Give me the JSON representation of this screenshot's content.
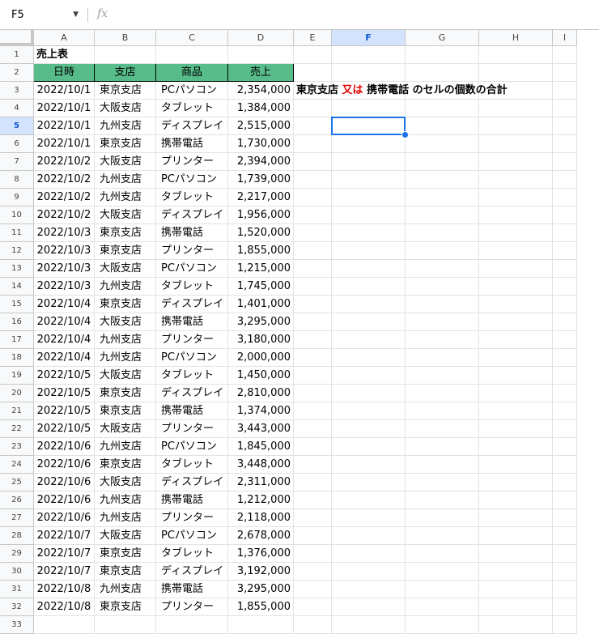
{
  "name_box": "F5",
  "formula": "",
  "columns": [
    "A",
    "B",
    "C",
    "D",
    "E",
    "F",
    "G",
    "H",
    "I"
  ],
  "selected_column": "F",
  "selected_row": 5,
  "sheet_title": "売上表",
  "headers": [
    "日時",
    "支店",
    "商品",
    "売上"
  ],
  "note": {
    "part1": "東京支店",
    "red": "又は",
    "part2": "携帯電話",
    "part3": "のセルの個数の合計"
  },
  "rows": [
    [
      "2022/10/1",
      "東京支店",
      "PCパソコン",
      "2,354,000"
    ],
    [
      "2022/10/1",
      "大阪支店",
      "タブレット",
      "1,384,000"
    ],
    [
      "2022/10/1",
      "九州支店",
      "ディスプレイ",
      "2,515,000"
    ],
    [
      "2022/10/1",
      "東京支店",
      "携帯電話",
      "1,730,000"
    ],
    [
      "2022/10/2",
      "大阪支店",
      "プリンター",
      "2,394,000"
    ],
    [
      "2022/10/2",
      "九州支店",
      "PCパソコン",
      "1,739,000"
    ],
    [
      "2022/10/2",
      "九州支店",
      "タブレット",
      "2,217,000"
    ],
    [
      "2022/10/2",
      "大阪支店",
      "ディスプレイ",
      "1,956,000"
    ],
    [
      "2022/10/3",
      "東京支店",
      "携帯電話",
      "1,520,000"
    ],
    [
      "2022/10/3",
      "東京支店",
      "プリンター",
      "1,855,000"
    ],
    [
      "2022/10/3",
      "大阪支店",
      "PCパソコン",
      "1,215,000"
    ],
    [
      "2022/10/3",
      "九州支店",
      "タブレット",
      "1,745,000"
    ],
    [
      "2022/10/4",
      "東京支店",
      "ディスプレイ",
      "1,401,000"
    ],
    [
      "2022/10/4",
      "大阪支店",
      "携帯電話",
      "3,295,000"
    ],
    [
      "2022/10/4",
      "九州支店",
      "プリンター",
      "3,180,000"
    ],
    [
      "2022/10/4",
      "九州支店",
      "PCパソコン",
      "2,000,000"
    ],
    [
      "2022/10/5",
      "大阪支店",
      "タブレット",
      "1,450,000"
    ],
    [
      "2022/10/5",
      "東京支店",
      "ディスプレイ",
      "2,810,000"
    ],
    [
      "2022/10/5",
      "東京支店",
      "携帯電話",
      "1,374,000"
    ],
    [
      "2022/10/5",
      "大阪支店",
      "プリンター",
      "3,443,000"
    ],
    [
      "2022/10/6",
      "九州支店",
      "PCパソコン",
      "1,845,000"
    ],
    [
      "2022/10/6",
      "東京支店",
      "タブレット",
      "3,448,000"
    ],
    [
      "2022/10/6",
      "大阪支店",
      "ディスプレイ",
      "2,311,000"
    ],
    [
      "2022/10/6",
      "九州支店",
      "携帯電話",
      "1,212,000"
    ],
    [
      "2022/10/6",
      "九州支店",
      "プリンター",
      "2,118,000"
    ],
    [
      "2022/10/7",
      "大阪支店",
      "PCパソコン",
      "2,678,000"
    ],
    [
      "2022/10/7",
      "東京支店",
      "タブレット",
      "1,376,000"
    ],
    [
      "2022/10/7",
      "東京支店",
      "ディスプレイ",
      "3,192,000"
    ],
    [
      "2022/10/8",
      "九州支店",
      "携帯電話",
      "3,295,000"
    ],
    [
      "2022/10/8",
      "東京支店",
      "プリンター",
      "1,855,000"
    ]
  ],
  "row_numbers": [
    "1",
    "2",
    "3",
    "4",
    "5",
    "6",
    "7",
    "8",
    "9",
    "10",
    "11",
    "12",
    "13",
    "14",
    "15",
    "16",
    "17",
    "18",
    "19",
    "20",
    "21",
    "22",
    "23",
    "24",
    "25",
    "26",
    "27",
    "28",
    "29",
    "30",
    "31",
    "32",
    "33"
  ],
  "colors": {
    "header_green": "#57bb8a",
    "selection": "#1a73e8",
    "note_red": "#e50000"
  }
}
